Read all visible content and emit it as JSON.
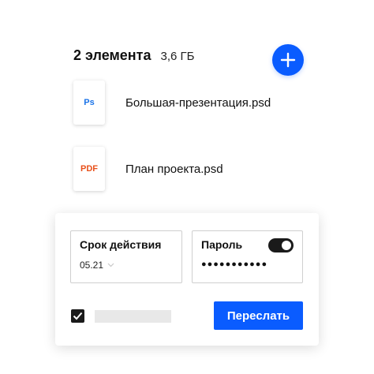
{
  "header": {
    "count": "2 элемента",
    "size": "3,6 ГБ"
  },
  "files": [
    {
      "badge": "Ps",
      "badge_color": "#1a73e8",
      "name": "Большая-презентация.psd"
    },
    {
      "badge": "PDF",
      "badge_color": "#e8501a",
      "name": "План проекта.psd"
    }
  ],
  "panel": {
    "expiry": {
      "label": "Срок действия",
      "value": "05.21"
    },
    "password": {
      "label": "Пароль",
      "dots": "●●●●●●●●●●●",
      "enabled": true
    },
    "checkbox_checked": true,
    "send_label": "Переслать"
  },
  "accent_color": "#0a5cff"
}
